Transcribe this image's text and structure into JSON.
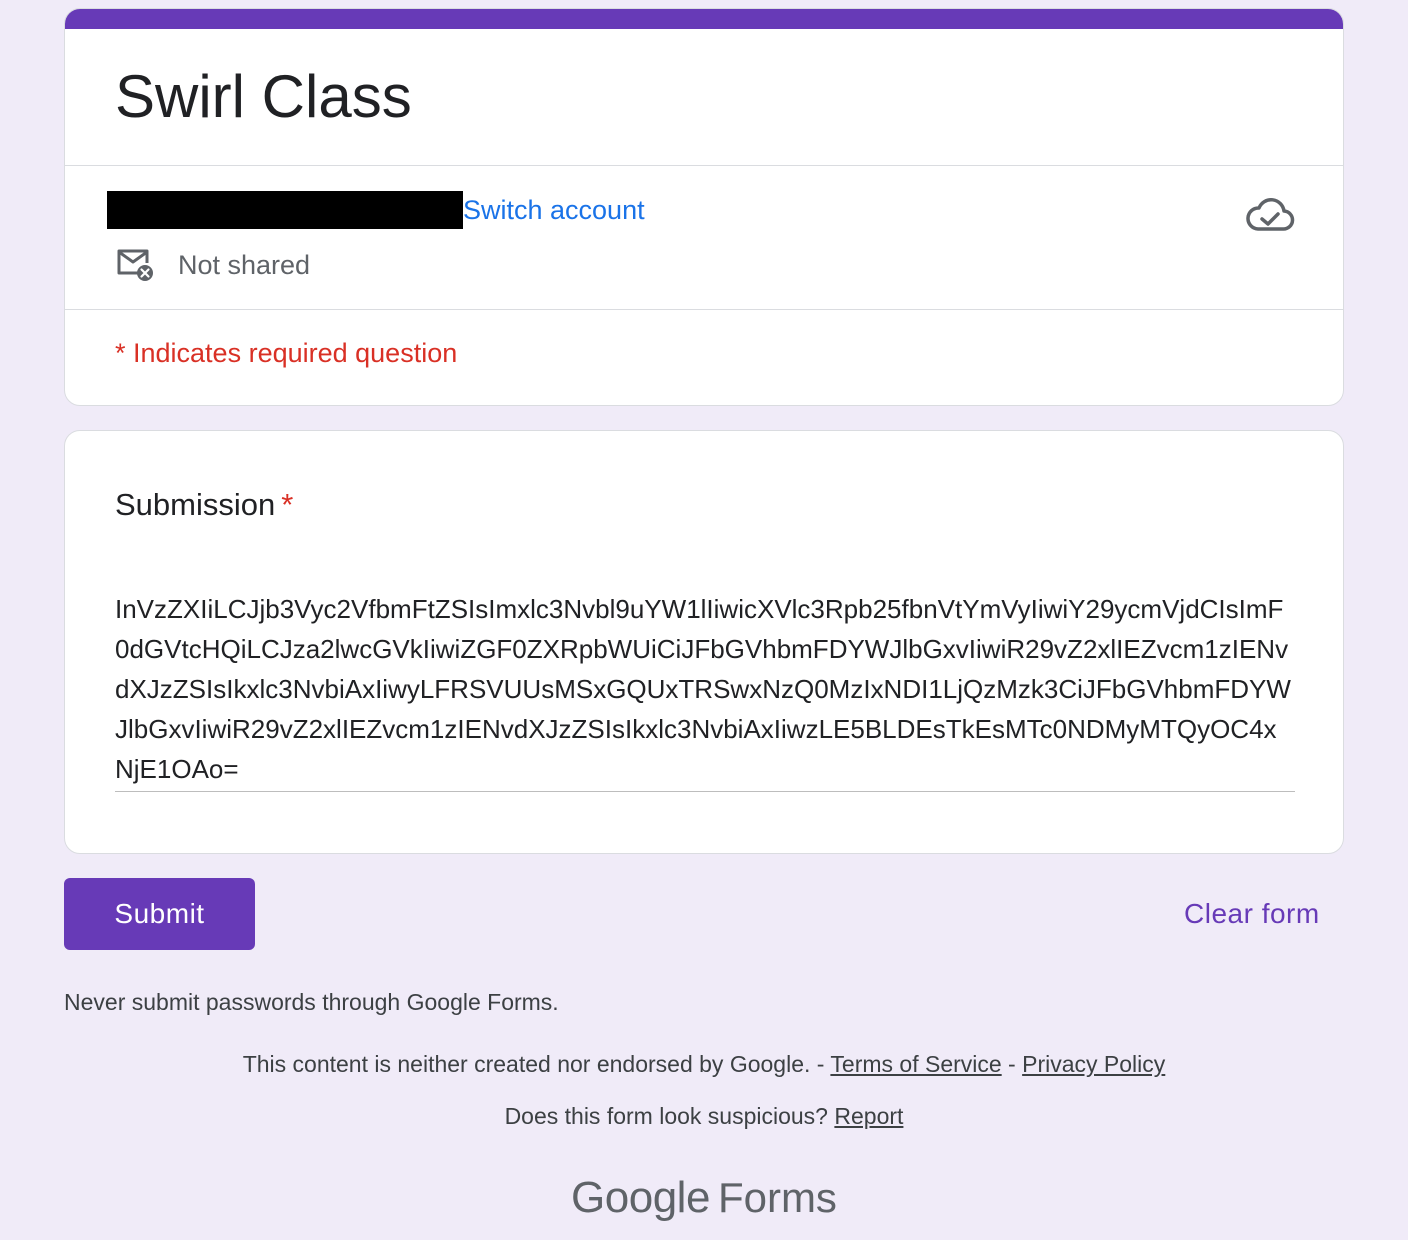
{
  "form": {
    "title": "Swirl Class",
    "switch_account_label": "Switch account",
    "not_shared_label": "Not shared",
    "required_note": "* Indicates required question"
  },
  "question": {
    "title": "Submission",
    "required_marker": "*",
    "answer": "InVzZXIiLCJjb3Vyc2VfbmFtZSIsImxlc3Nvbl9uYW1lIiwicXVlc3Rpb25fbnVtYmVyIiwiY29ycmVjdCIsImF0dGVtcHQiLCJza2lwcGVkIiwiZGF0ZXRpbWUiCiJFbGVhbmFDYWJlbGxvIiwiR29vZ2xlIEZvcm1zIENvdXJzZSIsIkxlc3NvbiAxIiwyLFRSVUUsMSxGQUxTRSwxNzQ0MzIxNDI1LjQzMzk3CiJFbGVhbmFDYWJlbGxvIiwiR29vZ2xlIEZvcm1zIENvdXJzZSIsIkxlc3NvbiAxIiwzLE5BLDEsTkEsMTc0NDMyMTQyOC4xNjE1OAo="
  },
  "actions": {
    "submit_label": "Submit",
    "clear_label": "Clear form"
  },
  "footer": {
    "password_warning": "Never submit passwords through Google Forms.",
    "disclaimer_text": "This content is neither created nor endorsed by Google. - ",
    "terms_label": "Terms of Service",
    "separator": " - ",
    "privacy_label": "Privacy Policy",
    "suspicious_text": "Does this form look suspicious? ",
    "report_label": "Report",
    "brand_google": "Google",
    "brand_forms": "Forms"
  },
  "colors": {
    "accent": "#673ab7",
    "background": "#f0ebf8",
    "link": "#1a73e8",
    "required": "#d93025"
  },
  "icons": {
    "cloud": "cloud-check-icon",
    "mail": "mail-not-shared-icon"
  }
}
